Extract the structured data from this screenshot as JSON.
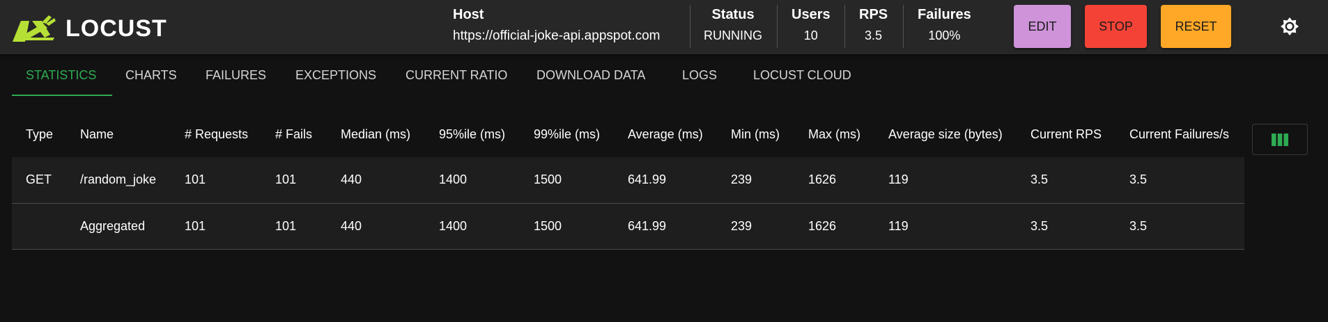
{
  "app": {
    "name": "LOCUST"
  },
  "header": {
    "host": {
      "label": "Host",
      "value": "https://official-joke-api.appspot.com"
    },
    "status": {
      "label": "Status",
      "value": "RUNNING"
    },
    "users": {
      "label": "Users",
      "value": "10"
    },
    "rps": {
      "label": "RPS",
      "value": "3.5"
    },
    "failures": {
      "label": "Failures",
      "value": "100%"
    },
    "buttons": {
      "edit": "EDIT",
      "stop": "STOP",
      "reset": "RESET"
    }
  },
  "colors": {
    "accent_green": "#2eab53",
    "logo_green": "#b6e035",
    "edit_button": "#ce93d8",
    "stop_button": "#f44336",
    "reset_button": "#ffa726",
    "header_bg": "#272727",
    "page_bg": "#121212"
  },
  "tabs": [
    {
      "label": "STATISTICS",
      "active": true
    },
    {
      "label": "CHARTS"
    },
    {
      "label": "FAILURES"
    },
    {
      "label": "EXCEPTIONS"
    },
    {
      "label": "CURRENT RATIO"
    },
    {
      "label": "DOWNLOAD DATA"
    },
    {
      "label": "LOGS"
    },
    {
      "label": "LOCUST CLOUD"
    }
  ],
  "table": {
    "columns": [
      "Type",
      "Name",
      "# Requests",
      "# Fails",
      "Median (ms)",
      "95%ile (ms)",
      "99%ile (ms)",
      "Average (ms)",
      "Min (ms)",
      "Max (ms)",
      "Average size (bytes)",
      "Current RPS",
      "Current Failures/s"
    ],
    "rows": [
      [
        "GET",
        "/random_joke",
        "101",
        "101",
        "440",
        "1400",
        "1500",
        "641.99",
        "239",
        "1626",
        "119",
        "3.5",
        "3.5"
      ],
      [
        "",
        "Aggregated",
        "101",
        "101",
        "440",
        "1400",
        "1500",
        "641.99",
        "239",
        "1626",
        "119",
        "3.5",
        "3.5"
      ]
    ]
  },
  "icons": {
    "logo": "locust-logo-icon",
    "theme": "brightness-icon",
    "columns": "view-column-icon"
  }
}
